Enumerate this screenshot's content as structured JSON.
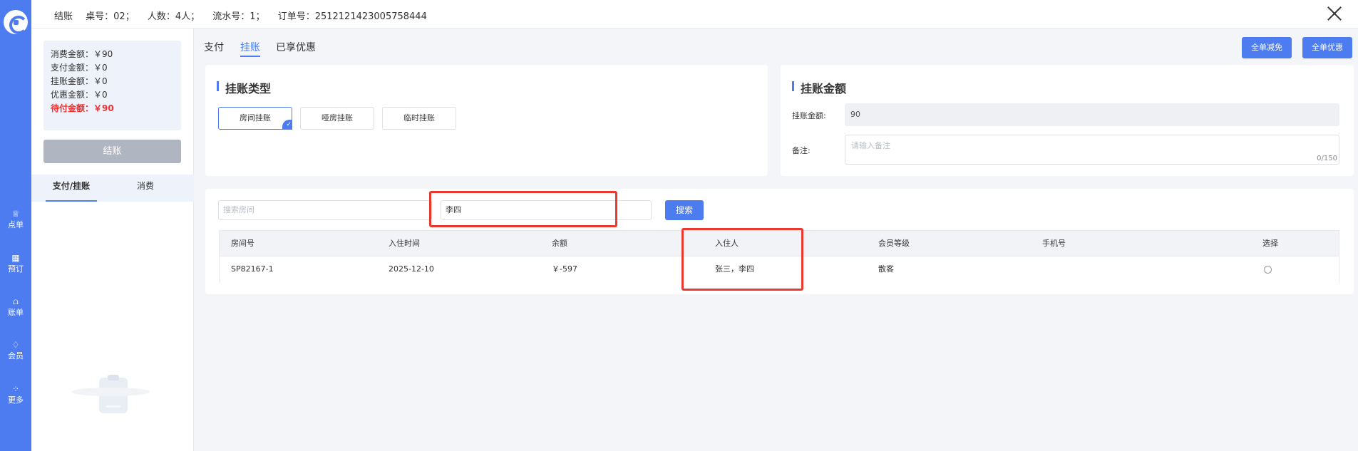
{
  "rail": {
    "items": [
      {
        "icon": "order-icon",
        "glyph": "♕",
        "label": "点单"
      },
      {
        "icon": "booking-icon",
        "glyph": "▦",
        "label": "预订"
      },
      {
        "icon": "bill-icon",
        "glyph": "⩍",
        "label": "账单"
      },
      {
        "icon": "member-icon",
        "glyph": "♢",
        "label": "会员"
      },
      {
        "icon": "more-icon",
        "glyph": "⁘",
        "label": "更多"
      }
    ]
  },
  "header": {
    "title": "结账",
    "table": "桌号：02；",
    "guests": "人数：4人；",
    "serial": "流水号：1；",
    "order": "订单号：2512121423005758444"
  },
  "summary": {
    "consume": "消费金额：￥90",
    "paid": "支付金额：￥0",
    "charged": "挂账金额：￥0",
    "discount": "优惠金额：￥0",
    "due": "待付金额：￥90"
  },
  "checkout_label": "结账",
  "left_tabs": {
    "pay": "支付/挂账",
    "consume": "消费"
  },
  "main_tabs": {
    "pay": "支付",
    "charge": "挂账",
    "offers": "已享优惠"
  },
  "top_buttons": {
    "waive": "全单减免",
    "offer": "全单优惠"
  },
  "charge_type": {
    "title": "挂账类型",
    "options": [
      "房间挂账",
      "哑房挂账",
      "临时挂账"
    ],
    "selected": "房间挂账"
  },
  "charge_amount": {
    "title": "挂账金额",
    "amount_label": "挂账金额:",
    "amount_value": "90",
    "remark_label": "备注:",
    "remark_placeholder": "请输入备注",
    "remark_count": "0/150"
  },
  "search": {
    "room_placeholder": "搜索房间",
    "guest_value": "李四",
    "button": "搜索"
  },
  "table": {
    "headers": [
      "房间号",
      "入住时间",
      "余额",
      "入住人",
      "会员等级",
      "手机号",
      "选择"
    ],
    "rows": [
      [
        "SP82167-1",
        "2025-12-10",
        "￥-597",
        "张三，李四",
        "散客",
        ""
      ]
    ]
  },
  "colors": {
    "accent": "#4c7cf0",
    "due": "#f0312f",
    "highlight": "#e8392f"
  }
}
